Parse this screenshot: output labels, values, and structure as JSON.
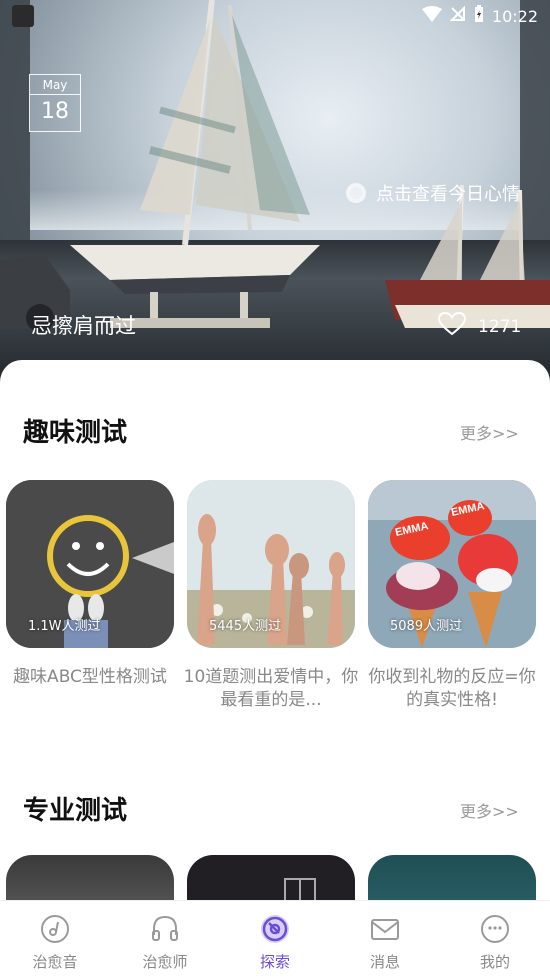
{
  "status_bar": {
    "time": "10:22"
  },
  "hero": {
    "month": "May",
    "day": "18",
    "mood_link": "点击查看今日心情",
    "title": "忌擦肩而过",
    "likes": "1271"
  },
  "fun_tests": {
    "title": "趣味测试",
    "more": "更多>>",
    "items": [
      {
        "count": "1.1W人测过",
        "caption": "趣味ABC型性格测试"
      },
      {
        "count": "5445人测过",
        "caption": "10道题测出爱情中，你最看重的是..."
      },
      {
        "count": "5089人测过",
        "caption": "你收到礼物的反应=你的真实性格!"
      }
    ]
  },
  "pro_tests": {
    "title": "专业测试",
    "more": "更多>>"
  },
  "nav": {
    "items": [
      {
        "label": "治愈音"
      },
      {
        "label": "治愈师"
      },
      {
        "label": "探索"
      },
      {
        "label": "消息"
      },
      {
        "label": "我的"
      }
    ],
    "active_color": "#6c4dd8",
    "inactive_color": "#888888"
  }
}
